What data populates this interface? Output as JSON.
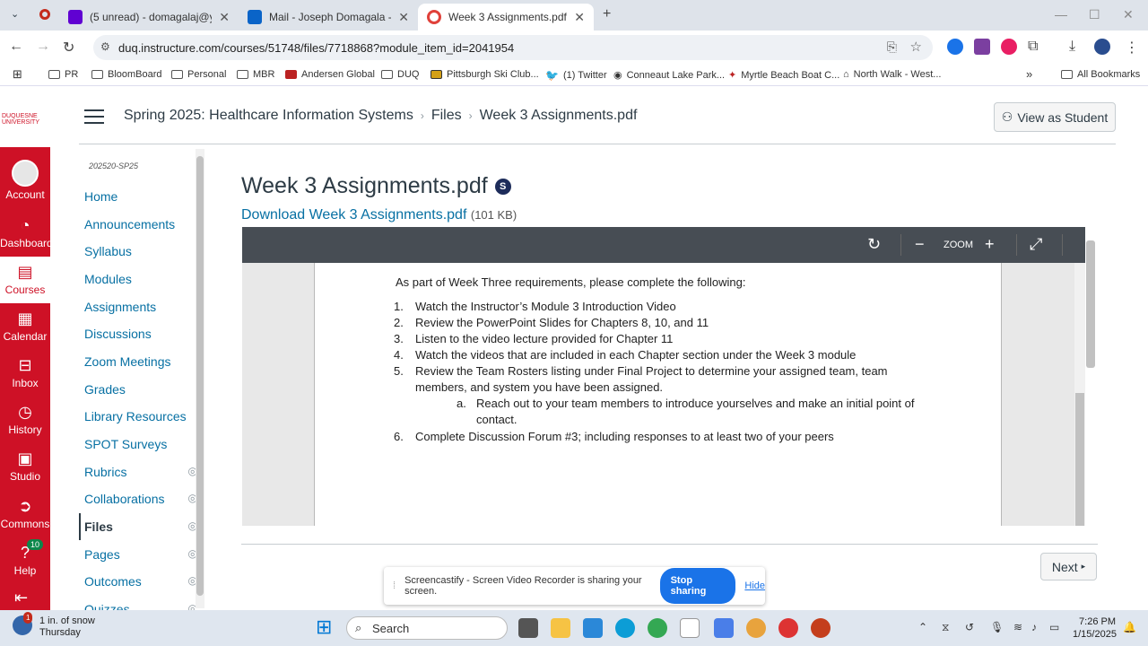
{
  "browser": {
    "tabs": [
      {
        "title": "(5 unread) - domagalaj@yahoo",
        "active": false
      },
      {
        "title": "Mail - Joseph Domagala - Outl",
        "active": false
      },
      {
        "title": "Week 3 Assignments.pdf: HAD",
        "active": true
      }
    ],
    "new_tab": "+",
    "url": "duq.instructure.com/courses/51748/files/7718868?module_item_id=2041954",
    "bookmarks": [
      "PR",
      "BloomBoard",
      "Personal",
      "MBR",
      "Andersen Global",
      "DUQ",
      "Pittsburgh Ski Club...",
      "(1) Twitter",
      "Conneaut Lake Park...",
      "Myrtle Beach Boat C...",
      "North Walk - West..."
    ],
    "all_bookmarks": "All Bookmarks"
  },
  "global_nav": {
    "logo": "DUQUESNE UNIVERSITY",
    "items": [
      {
        "label": "Account",
        "icon": "account-icon"
      },
      {
        "label": "Dashboard",
        "icon": "dashboard-icon"
      },
      {
        "label": "Courses",
        "icon": "courses-icon"
      },
      {
        "label": "Calendar",
        "icon": "calendar-icon"
      },
      {
        "label": "Inbox",
        "icon": "inbox-icon"
      },
      {
        "label": "History",
        "icon": "history-icon"
      },
      {
        "label": "Studio",
        "icon": "studio-icon"
      },
      {
        "label": "Commons",
        "icon": "commons-icon"
      },
      {
        "label": "Help",
        "icon": "help-icon",
        "badge": "10"
      }
    ]
  },
  "breadcrumb": {
    "course": "Spring 2025: Healthcare Information Systems",
    "section": "Files",
    "current": "Week 3 Assignments.pdf"
  },
  "view_as_student": "View as Student",
  "course_nav": {
    "term": "202520-SP25",
    "items": [
      {
        "label": "Home",
        "hidden": false
      },
      {
        "label": "Announcements",
        "hidden": false
      },
      {
        "label": "Syllabus",
        "hidden": false
      },
      {
        "label": "Modules",
        "hidden": false
      },
      {
        "label": "Assignments",
        "hidden": false
      },
      {
        "label": "Discussions",
        "hidden": false
      },
      {
        "label": "Zoom Meetings",
        "hidden": false
      },
      {
        "label": "Grades",
        "hidden": false
      },
      {
        "label": "Library Resources",
        "hidden": false
      },
      {
        "label": "SPOT Surveys",
        "hidden": false
      },
      {
        "label": "Rubrics",
        "hidden": true
      },
      {
        "label": "Collaborations",
        "hidden": true
      },
      {
        "label": "Files",
        "hidden": true,
        "active": true
      },
      {
        "label": "Pages",
        "hidden": true
      },
      {
        "label": "Outcomes",
        "hidden": true
      },
      {
        "label": "Quizzes",
        "hidden": true
      }
    ]
  },
  "main": {
    "title": "Week 3 Assignments.pdf",
    "download_label": "Download Week 3 Assignments.pdf",
    "file_size": "(101 KB)"
  },
  "viewer": {
    "zoom_label": "ZOOM",
    "intro": "As part of Week Three requirements, please complete the following:",
    "items": [
      {
        "n": "1.",
        "text": "Watch the Instructor’s Module 3 Introduction Video"
      },
      {
        "n": "2.",
        "text": "Review the PowerPoint Slides for Chapters 8, 10, and 11"
      },
      {
        "n": "3.",
        "text": "Listen to the video lecture provided for Chapter 11"
      },
      {
        "n": "4.",
        "text": "Watch the videos that are included in each Chapter section under the Week 3 module"
      },
      {
        "n": "5.",
        "text": "Review the Team Rosters listing under Final Project to determine your assigned team, team members, and system you have been assigned."
      },
      {
        "n": "6.",
        "text": "Complete Discussion Forum #3; including responses to at least two of your peers"
      }
    ],
    "sub_item": {
      "n": "a.",
      "text": "Reach out to your team members to introduce yourselves and make an initial point of contact."
    }
  },
  "next_label": "Next",
  "share_bar": {
    "message": "Screencastify - Screen Video Recorder is sharing your screen.",
    "stop_label": "Stop sharing",
    "hide_label": "Hide"
  },
  "taskbar": {
    "weather_temp": "1 in. of snow",
    "weather_day": "Thursday",
    "weather_badge": "1",
    "search_label": "Search",
    "time": "7:26 PM",
    "date": "1/15/2025"
  }
}
